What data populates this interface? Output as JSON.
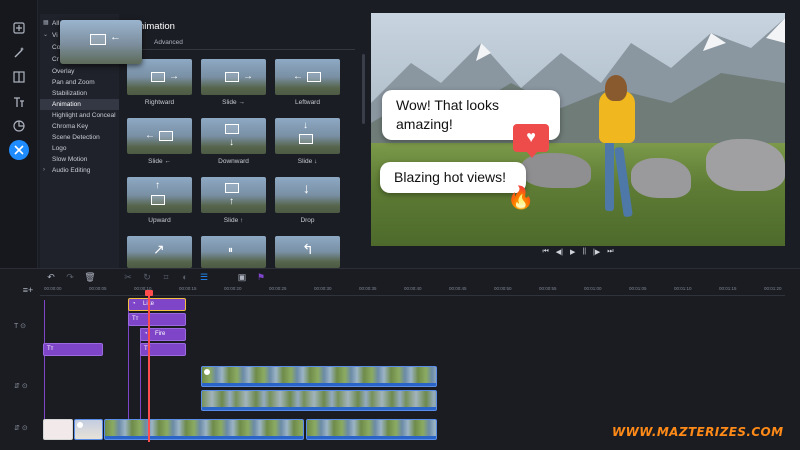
{
  "categories": {
    "items": [
      {
        "label": "All",
        "chevron": "",
        "active": false
      },
      {
        "label": "Vi",
        "chevron": "",
        "active": false
      },
      {
        "label": "Co",
        "chevron": "",
        "active": false
      },
      {
        "label": "Cr",
        "chevron": "",
        "active": false
      },
      {
        "label": "Overlay",
        "chevron": "",
        "active": false
      },
      {
        "label": "Pan and Zoom",
        "chevron": "",
        "active": false
      },
      {
        "label": "Stabilization",
        "chevron": "",
        "active": false
      },
      {
        "label": "Animation",
        "chevron": "",
        "active": true
      },
      {
        "label": "Highlight and Conceal",
        "chevron": "",
        "active": false
      },
      {
        "label": "Chroma Key",
        "chevron": "",
        "active": false
      },
      {
        "label": "Scene Detection",
        "chevron": "",
        "active": false
      },
      {
        "label": "Logo",
        "chevron": "",
        "active": false
      },
      {
        "label": "Slow Motion",
        "chevron": "",
        "active": false
      },
      {
        "label": "Audio Editing",
        "chevron": "›",
        "active": false
      }
    ]
  },
  "panel": {
    "title": "nimation",
    "tabs": [
      "",
      "Advanced"
    ],
    "tiles": [
      {
        "label": "Rightward",
        "glyph": "→"
      },
      {
        "label": "Slide →",
        "glyph": "→"
      },
      {
        "label": "Leftward",
        "glyph": "←"
      },
      {
        "label": "Slide ←",
        "glyph": "←"
      },
      {
        "label": "Downward",
        "glyph": "↓"
      },
      {
        "label": "Slide ↓",
        "glyph": "↓"
      },
      {
        "label": "Upward",
        "glyph": "↑"
      },
      {
        "label": "Slide ↑",
        "glyph": "↑"
      },
      {
        "label": "Drop",
        "glyph": "↓"
      },
      {
        "label": "",
        "glyph": "↗"
      },
      {
        "label": "",
        "glyph": "⏸"
      },
      {
        "label": "",
        "glyph": "↰"
      }
    ]
  },
  "preview": {
    "bubble1": "Wow! That looks amazing!",
    "bubble2": "Blazing hot views!",
    "heart_icon": "♥",
    "flame_icon": "🔥"
  },
  "transport": [
    "⏮",
    "◀|",
    "▶",
    "||",
    "|▶",
    "⏭"
  ],
  "timeline": {
    "ruler_labels": [
      "00:00:00",
      "00:00:05",
      "00:00:10",
      "00:00:15",
      "00:00:20",
      "00:00:25",
      "00:00:30",
      "00:00:35",
      "00:00:40",
      "00:00:45",
      "00:00:50",
      "00:00:55",
      "00:01:00",
      "00:01:05",
      "00:01:10",
      "00:01:15",
      "00:01:20"
    ],
    "clip_like": "Like",
    "clip_fire": "Fire"
  },
  "colors": {
    "accent": "#1e8cff",
    "text_clip": "#7f45c9",
    "playhead": "#ff4d4d",
    "watermark": "#ff8a17"
  },
  "watermark": "WWW.MAZTERIZES.COM"
}
